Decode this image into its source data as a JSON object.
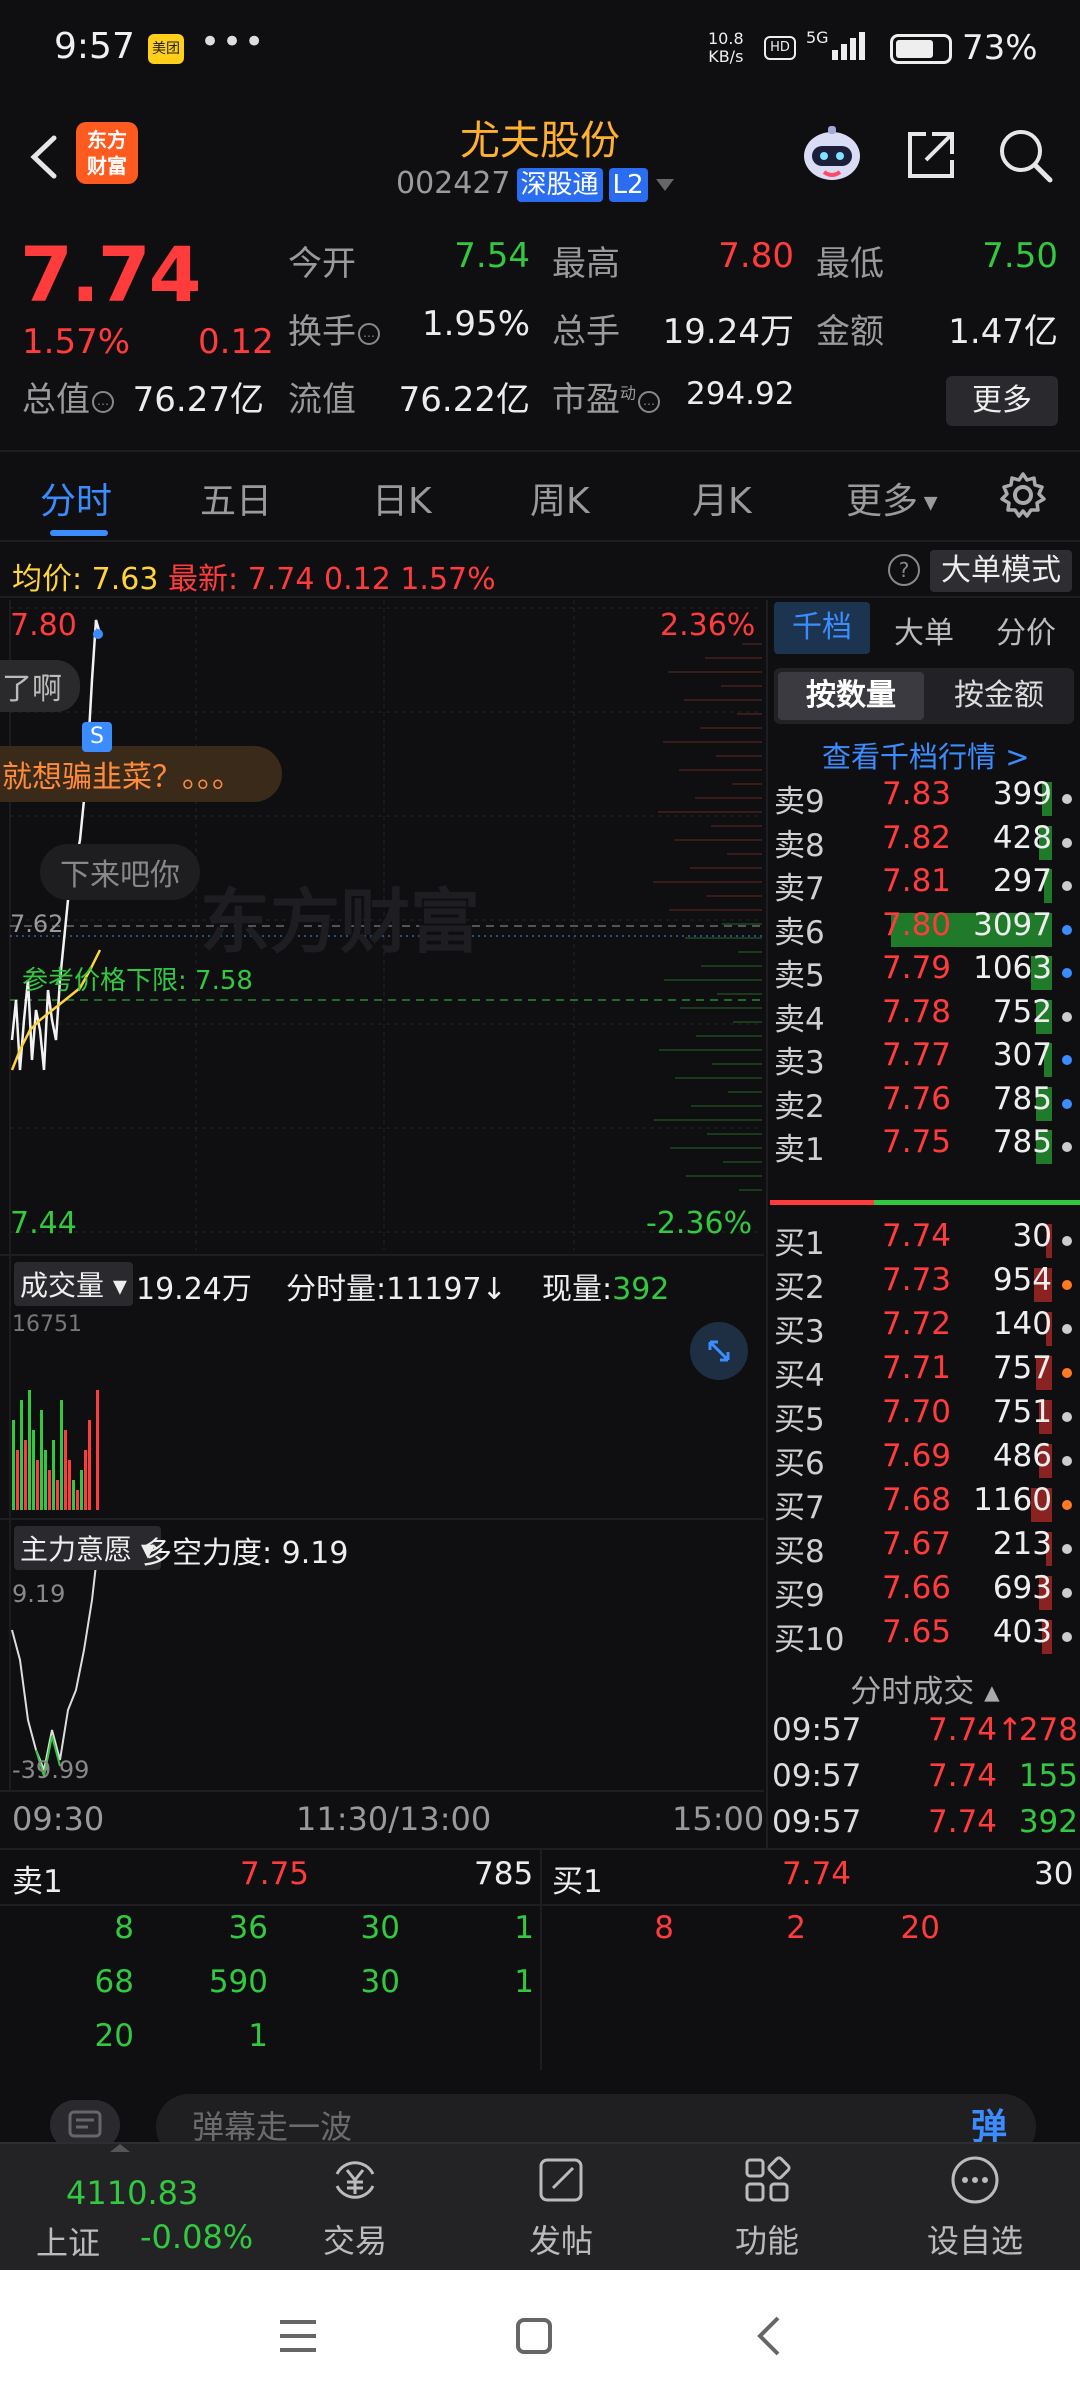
{
  "status_bar": {
    "time": "9:57",
    "app_badge": "美团",
    "net_speed_top": "10.8",
    "net_speed_bottom": "KB/s",
    "hd": "HD",
    "signal": "5G",
    "battery_pct": "73%",
    "battery_level": 0.73
  },
  "header": {
    "brand": "东方\n财富",
    "stock_name": "尤夫股份",
    "stock_code": "002427",
    "tag_connect": "深股通",
    "tag_level": "L2"
  },
  "quote": {
    "price": "7.74",
    "change_pct": "1.57%",
    "change": "0.12",
    "open_label": "今开",
    "open": "7.54",
    "high_label": "最高",
    "high": "7.80",
    "low_label": "最低",
    "low": "7.50",
    "turnover_label": "换手",
    "turnover": "1.95%",
    "volume_label": "总手",
    "volume": "19.24万",
    "amount_label": "金额",
    "amount": "1.47亿",
    "mktcap_label": "总值",
    "mktcap": "76.27亿",
    "float_label": "流值",
    "float_cap": "76.22亿",
    "pe_label": "市盈",
    "pe_sup": "动",
    "pe": "294.92",
    "more_label": "更多"
  },
  "tabs": [
    "分时",
    "五日",
    "日K",
    "周K",
    "月K",
    "更多"
  ],
  "avg_bar": {
    "avg_label": "均价:",
    "avg": "7.63",
    "latest_label": "最新:",
    "latest": "7.74",
    "latest_chg": "0.12",
    "latest_pct": "1.57%",
    "big_mode": "大单模式"
  },
  "chart": {
    "y_top": "7.80",
    "y_bottom": "7.44",
    "pct_top": "2.36%",
    "pct_bottom": "-2.36%",
    "ref_price": "7.62",
    "lower_limit_label": "参考价格下限:",
    "lower_limit": "7.58",
    "danmaku": [
      "了啊",
      "就想骗韭菜？。。。",
      "下来吧你"
    ],
    "s_marker": "S",
    "watermark": "东方财富",
    "vol_selector": "成交量",
    "vol_total": "19.24万",
    "vol_minute_label": "分时量:",
    "vol_minute": "11197↓",
    "vol_now_label": "现量:",
    "vol_now": "392",
    "vol_axis_max": "16751",
    "force_selector": "主力意愿",
    "force_label": "多空力度:",
    "force_value": "9.19",
    "force_top": "9.19",
    "force_bottom": "-39.99",
    "time_start": "09:30",
    "time_mid": "11:30/13:00",
    "time_end": "15:00"
  },
  "order_book": {
    "tabs": [
      "千档",
      "大单",
      "分价"
    ],
    "seg_on": "按数量",
    "seg_off": "按金额",
    "link": "查看千档行情 >",
    "asks": [
      {
        "label": "卖9",
        "price": "7.83",
        "vol": "399",
        "share": 0.04,
        "dot": "#cccccc"
      },
      {
        "label": "卖8",
        "price": "7.82",
        "vol": "428",
        "share": 0.05,
        "dot": "#cccccc"
      },
      {
        "label": "卖7",
        "price": "7.81",
        "vol": "297",
        "share": 0.03,
        "dot": "#cccccc"
      },
      {
        "label": "卖6",
        "price": "7.80",
        "vol": "3097",
        "share": 0.62,
        "dot": "#3b8dff"
      },
      {
        "label": "卖5",
        "price": "7.79",
        "vol": "1063",
        "share": 0.08,
        "dot": "#3b8dff"
      },
      {
        "label": "卖4",
        "price": "7.78",
        "vol": "752",
        "share": 0.06,
        "dot": "#cccccc"
      },
      {
        "label": "卖3",
        "price": "7.77",
        "vol": "307",
        "share": 0.03,
        "dot": "#3b8dff"
      },
      {
        "label": "卖2",
        "price": "7.76",
        "vol": "785",
        "share": 0.06,
        "dot": "#3b8dff"
      },
      {
        "label": "卖1",
        "price": "7.75",
        "vol": "785",
        "share": 0.06,
        "dot": "#cccccc"
      }
    ],
    "bids": [
      {
        "label": "买1",
        "price": "7.74",
        "vol": "30",
        "share": 0.0,
        "dot": "#cccccc"
      },
      {
        "label": "买2",
        "price": "7.73",
        "vol": "954",
        "share": 0.07,
        "dot": "#ff7a22"
      },
      {
        "label": "买3",
        "price": "7.72",
        "vol": "140",
        "share": 0.01,
        "dot": "#cccccc"
      },
      {
        "label": "买4",
        "price": "7.71",
        "vol": "757",
        "share": 0.06,
        "dot": "#ff7a22"
      },
      {
        "label": "买5",
        "price": "7.70",
        "vol": "751",
        "share": 0.05,
        "dot": "#cccccc"
      },
      {
        "label": "买6",
        "price": "7.69",
        "vol": "486",
        "share": 0.05,
        "dot": "#cccccc"
      },
      {
        "label": "买7",
        "price": "7.68",
        "vol": "1160",
        "share": 0.08,
        "dot": "#ff7a22"
      },
      {
        "label": "买8",
        "price": "7.67",
        "vol": "213",
        "share": 0.02,
        "dot": "#cccccc"
      },
      {
        "label": "买9",
        "price": "7.66",
        "vol": "693",
        "share": 0.05,
        "dot": "#cccccc"
      },
      {
        "label": "买10",
        "price": "7.65",
        "vol": "403",
        "share": 0.04,
        "dot": "#cccccc"
      }
    ],
    "trades_title": "分时成交",
    "trades": [
      {
        "time": "09:57",
        "price": "7.74↑",
        "vol": "278",
        "vol_color": "#ff3b3b"
      },
      {
        "time": "09:57",
        "price": "7.74",
        "vol": "155",
        "vol_color": "#32c840"
      },
      {
        "time": "09:57",
        "price": "7.74",
        "vol": "392",
        "vol_color": "#32c840"
      }
    ]
  },
  "ticks": {
    "sell_label": "卖1",
    "sell_price": "7.75",
    "sell_vol": "785",
    "buy_label": "买1",
    "buy_price": "7.74",
    "buy_vol": "30",
    "sell_rows": [
      [
        "8",
        "36",
        "30",
        "1"
      ],
      [
        "68",
        "590",
        "30",
        "1"
      ],
      [
        "20",
        "1",
        "",
        ""
      ]
    ],
    "buy_rows": [
      [
        "8",
        "2",
        "20"
      ]
    ]
  },
  "comment": {
    "placeholder": "弹幕走一波",
    "send": "弹"
  },
  "bottom_bar": {
    "index_value": "4110.83",
    "index_name": "上证",
    "index_change": "-0.08%",
    "trade": "交易",
    "post": "发帖",
    "functions": "功能",
    "add_watch": "设自选"
  },
  "colors": {
    "up": "#ff3b3b",
    "down": "#32c840",
    "accent": "#3b8dff",
    "brand": "#ffb02e",
    "avg_line": "#ffd43a"
  }
}
